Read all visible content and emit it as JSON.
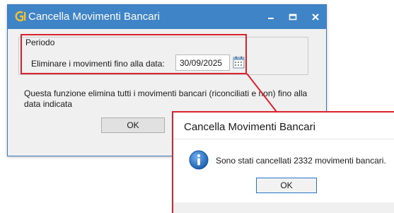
{
  "main_dialog": {
    "title": "Cancella Movimenti Bancari",
    "group_label": "Periodo",
    "field_label": "Eliminare i movimenti fino alla data:",
    "date_value": "30/09/2025",
    "description": "Questa funzione elimina tutti i movimenti bancari (riconciliati e non) fino alla data indicata",
    "ok_label": "OK",
    "icons": {
      "app": "app-logo-icon",
      "minimize": "minimize-icon",
      "maximize": "maximize-icon",
      "close": "close-icon",
      "calendar": "calendar-icon"
    }
  },
  "result_dialog": {
    "title": "Cancella Movimenti Bancari",
    "message": "Sono stati cancellati 2332 movimenti bancari.",
    "ok_label": "OK",
    "icon": "info-icon"
  },
  "colors": {
    "titlebar": "#3e84c7",
    "highlight": "#d9232f",
    "window_bg": "#f0f0f0"
  }
}
